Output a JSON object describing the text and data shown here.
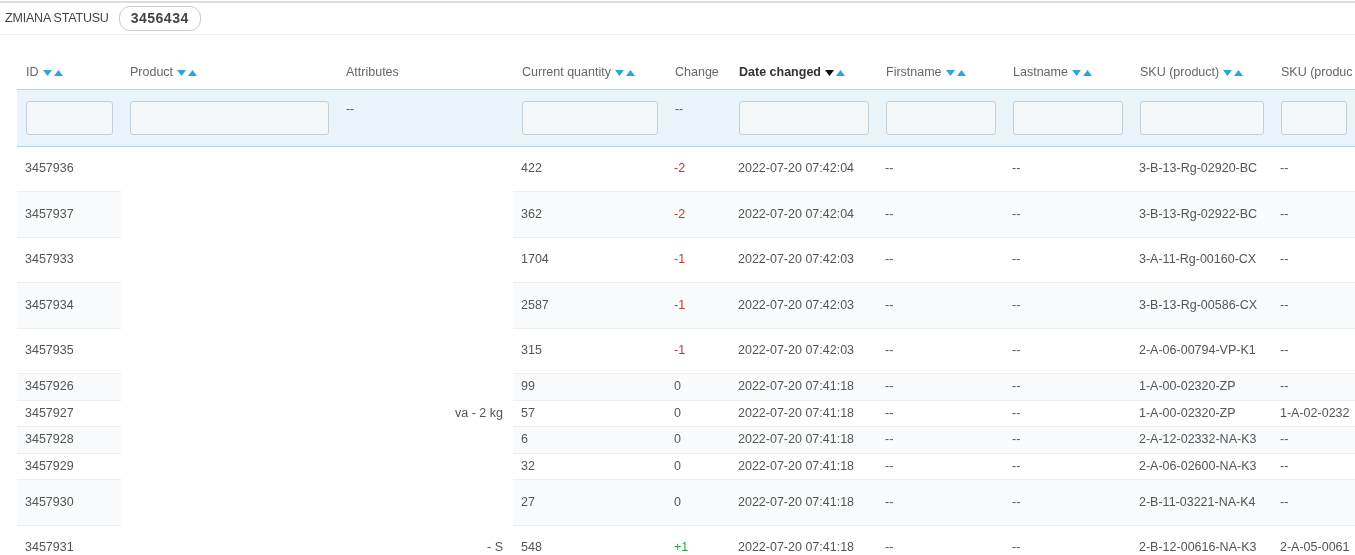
{
  "header": {
    "title": "ZMIANA STATUSU",
    "badge": "3456434"
  },
  "table": {
    "columns": [
      {
        "label": "ID",
        "sortable": true,
        "selected": false,
        "filter": {
          "kind": "input"
        }
      },
      {
        "label": "Product",
        "sortable": true,
        "selected": false,
        "filter": {
          "kind": "input"
        }
      },
      {
        "label": "Attributes",
        "sortable": false,
        "selected": false,
        "filter": {
          "kind": "text",
          "text": "--"
        }
      },
      {
        "label": "Current quantity",
        "sortable": true,
        "selected": false,
        "filter": {
          "kind": "input"
        }
      },
      {
        "label": "Change",
        "sortable": false,
        "selected": false,
        "filter": {
          "kind": "text",
          "text": "--"
        }
      },
      {
        "label": "Date changed",
        "sortable": true,
        "selected": true,
        "filter": {
          "kind": "input"
        }
      },
      {
        "label": "Firstname",
        "sortable": true,
        "selected": false,
        "filter": {
          "kind": "input"
        }
      },
      {
        "label": "Lastname",
        "sortable": true,
        "selected": false,
        "filter": {
          "kind": "input"
        }
      },
      {
        "label": "SKU (product)",
        "sortable": true,
        "selected": false,
        "filter": {
          "kind": "input"
        }
      },
      {
        "label": "SKU (produc",
        "selected": false,
        "filter": {
          "kind": "input"
        }
      }
    ],
    "rows": [
      {
        "id": "3457936",
        "quantity": "422",
        "change": {
          "text": "-2",
          "kind": "negative"
        },
        "date": "2022-07-20 07:42:04",
        "firstname": "--",
        "lastname": "--",
        "sku": "3-B-13-Rg-02920-BC",
        "sku2": "--"
      },
      {
        "id": "3457937",
        "quantity": "362",
        "change": {
          "text": "-2",
          "kind": "negative"
        },
        "date": "2022-07-20 07:42:04",
        "firstname": "--",
        "lastname": "--",
        "sku": "3-B-13-Rg-02922-BC",
        "sku2": "--"
      },
      {
        "id": "3457933",
        "quantity": "1704",
        "change": {
          "text": "-1",
          "kind": "negative"
        },
        "date": "2022-07-20 07:42:03",
        "firstname": "--",
        "lastname": "--",
        "sku": "3-A-11-Rg-00160-CX",
        "sku2": "--"
      },
      {
        "id": "3457934",
        "quantity": "2587",
        "change": {
          "text": "-1",
          "kind": "negative"
        },
        "date": "2022-07-20 07:42:03",
        "firstname": "--",
        "lastname": "--",
        "sku": "3-B-13-Rg-00586-CX",
        "sku2": "--"
      },
      {
        "id": "3457935",
        "quantity": "315",
        "change": {
          "text": "-1",
          "kind": "negative"
        },
        "date": "2022-07-20 07:42:03",
        "firstname": "--",
        "lastname": "--",
        "sku": "2-A-06-00794-VP-K1",
        "sku2": "--"
      },
      {
        "id": "3457926",
        "quantity": "99",
        "change": {
          "text": "0",
          "kind": "zero"
        },
        "date": "2022-07-20 07:41:18",
        "firstname": "--",
        "lastname": "--",
        "sku": "1-A-00-02320-ZP",
        "sku2": "--"
      },
      {
        "id": "3457927",
        "attributes": "va - 2 kg",
        "quantity": "57",
        "change": {
          "text": "0",
          "kind": "zero"
        },
        "date": "2022-07-20 07:41:18",
        "firstname": "--",
        "lastname": "--",
        "sku": "1-A-00-02320-ZP",
        "sku2": "1-A-02-0232"
      },
      {
        "id": "3457928",
        "quantity": "6",
        "change": {
          "text": "0",
          "kind": "zero"
        },
        "date": "2022-07-20 07:41:18",
        "firstname": "--",
        "lastname": "--",
        "sku": "2-A-12-02332-NA-K3",
        "sku2": "--"
      },
      {
        "id": "3457929",
        "quantity": "32",
        "change": {
          "text": "0",
          "kind": "zero"
        },
        "date": "2022-07-20 07:41:18",
        "firstname": "--",
        "lastname": "--",
        "sku": "2-A-06-02600-NA-K3",
        "sku2": "--"
      },
      {
        "id": "3457930",
        "quantity": "27",
        "change": {
          "text": "0",
          "kind": "zero"
        },
        "date": "2022-07-20 07:41:18",
        "firstname": "--",
        "lastname": "--",
        "sku": "2-B-11-03221-NA-K4",
        "sku2": "--"
      },
      {
        "id": "3457931",
        "attributes": "- S",
        "quantity": "548",
        "change": {
          "text": "+1",
          "kind": "positive"
        },
        "date": "2022-07-20 07:41:18",
        "firstname": "--",
        "lastname": "--",
        "sku": "2-B-12-00616-NA-K3",
        "sku2": "2-A-05-0061"
      }
    ]
  }
}
